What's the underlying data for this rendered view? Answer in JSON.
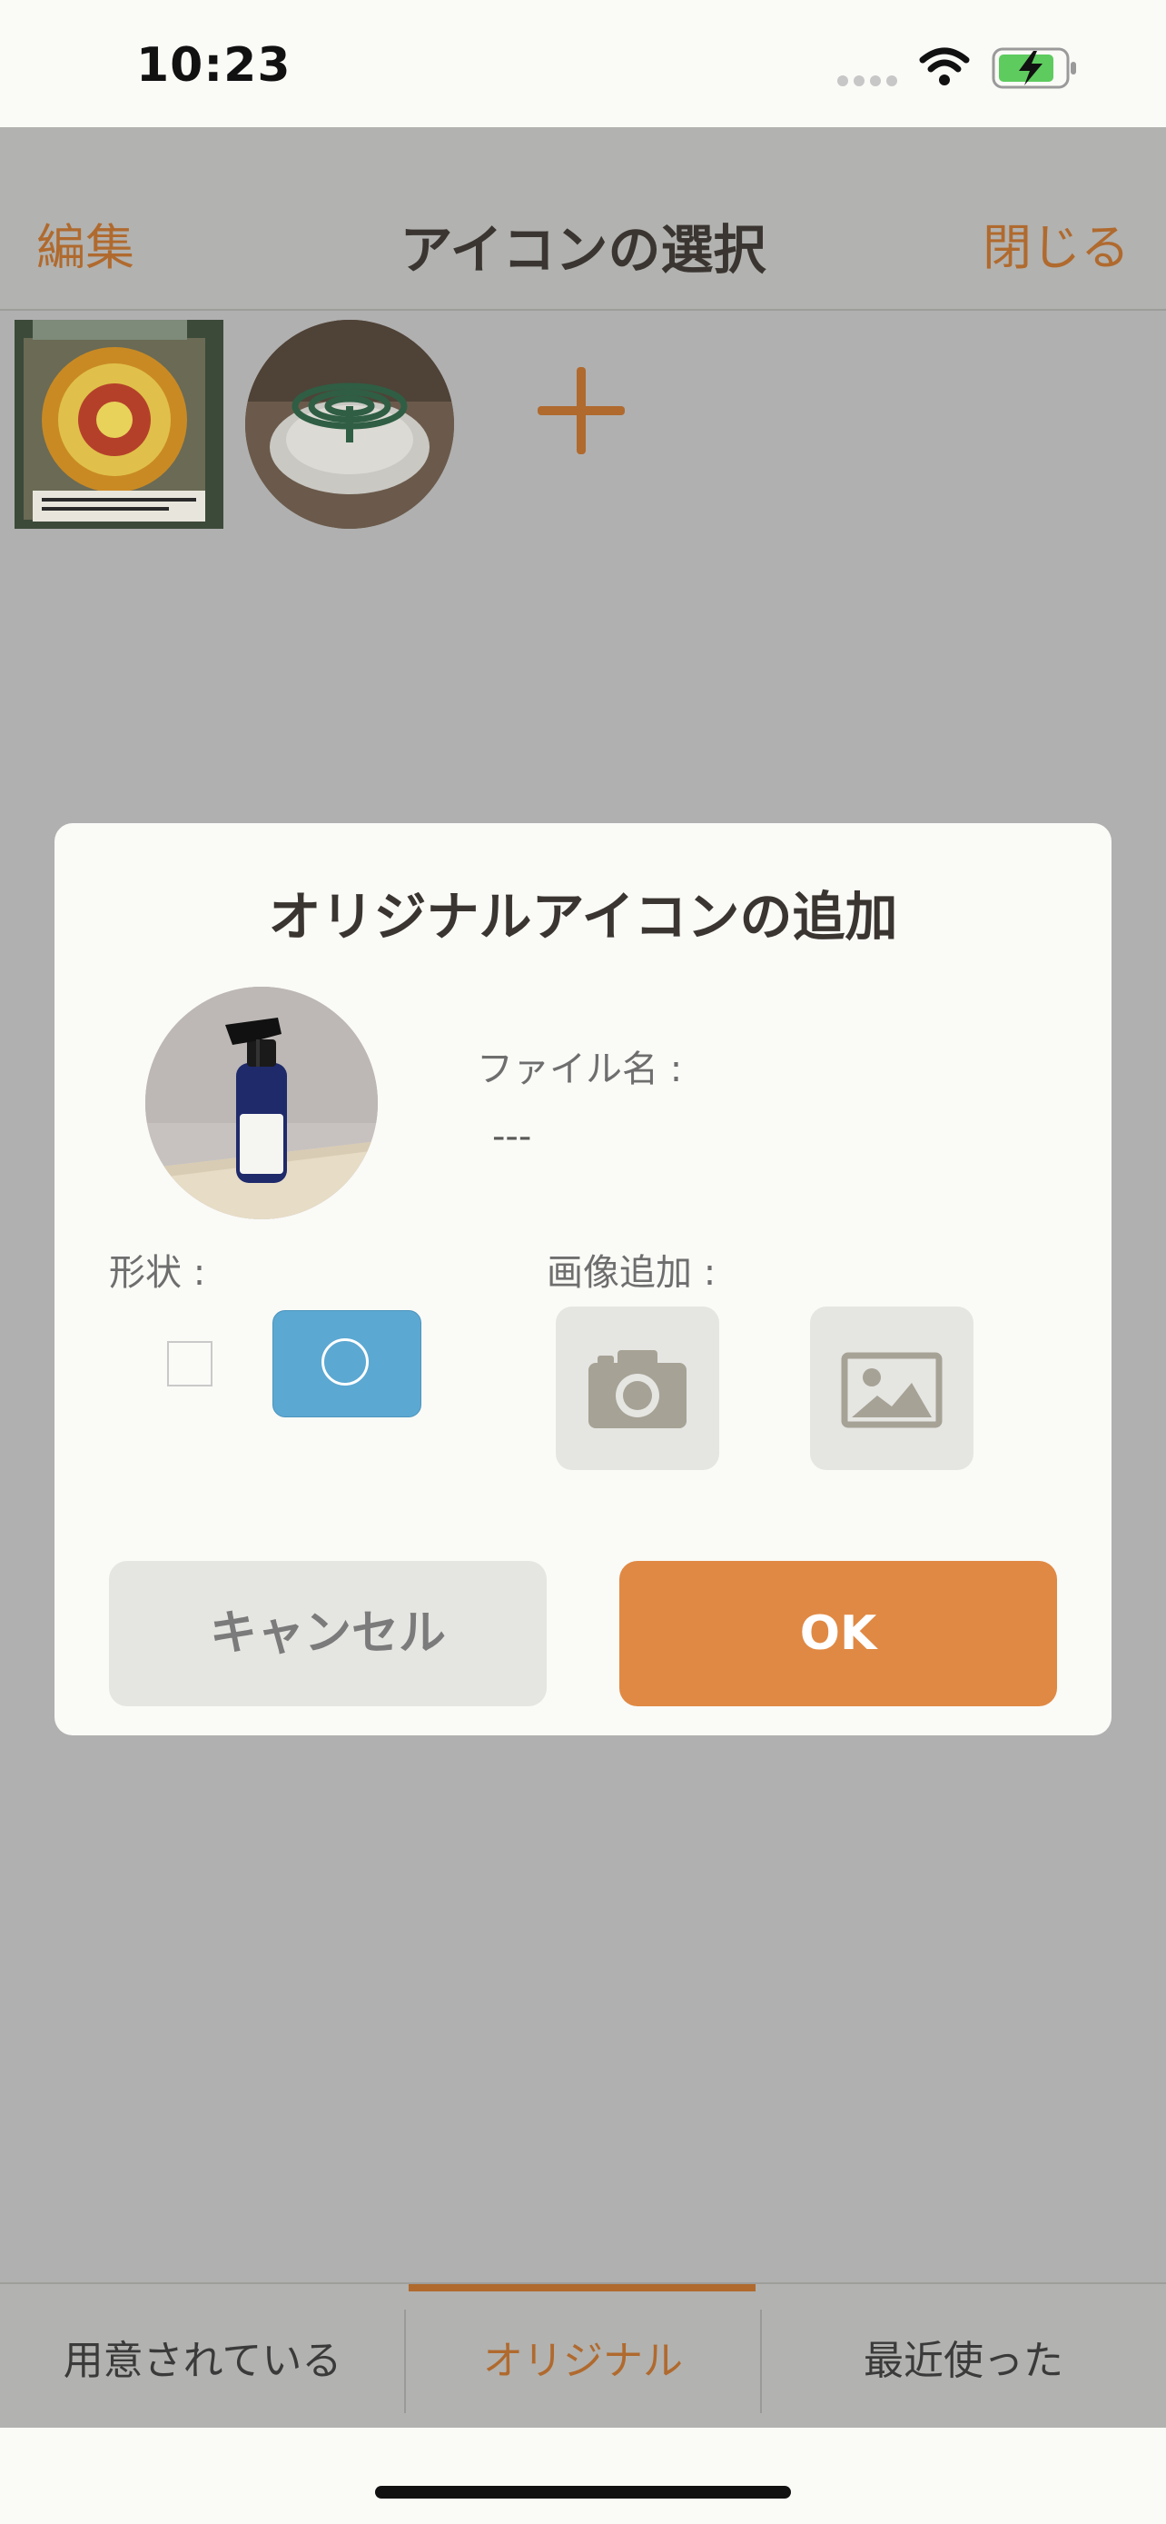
{
  "status_bar": {
    "time": "10:23",
    "icons": [
      "signal-icon",
      "wifi-icon",
      "battery-charging-icon"
    ]
  },
  "nav": {
    "edit": "編集",
    "title": "アイコンの選択",
    "close": "閉じる"
  },
  "icons_grid": {
    "items": [
      "flower-photo",
      "mosquito-coil-photo"
    ],
    "add_icon": "plus-icon"
  },
  "dialog": {
    "title": "オリジナルアイコンの追加",
    "preview": "spray-bottle-photo",
    "file_name_label": "ファイル名 :",
    "file_name_value": "---",
    "shape_label": "形状 :",
    "shape_options": [
      "square",
      "circle"
    ],
    "shape_selected": "circle",
    "image_add_label": "画像追加 :",
    "image_sources": [
      "camera-icon",
      "photo-library-icon"
    ],
    "cancel": "キャンセル",
    "ok": "OK"
  },
  "tabs": [
    {
      "label": "用意されている",
      "active": false
    },
    {
      "label": "オリジナル",
      "active": true
    },
    {
      "label": "最近使った",
      "active": false
    }
  ],
  "colors": {
    "accent": "#b06a2e",
    "ok_button": "#e08944",
    "selected_shape": "#5ba8d2",
    "overlay": "#b0b0b0"
  }
}
